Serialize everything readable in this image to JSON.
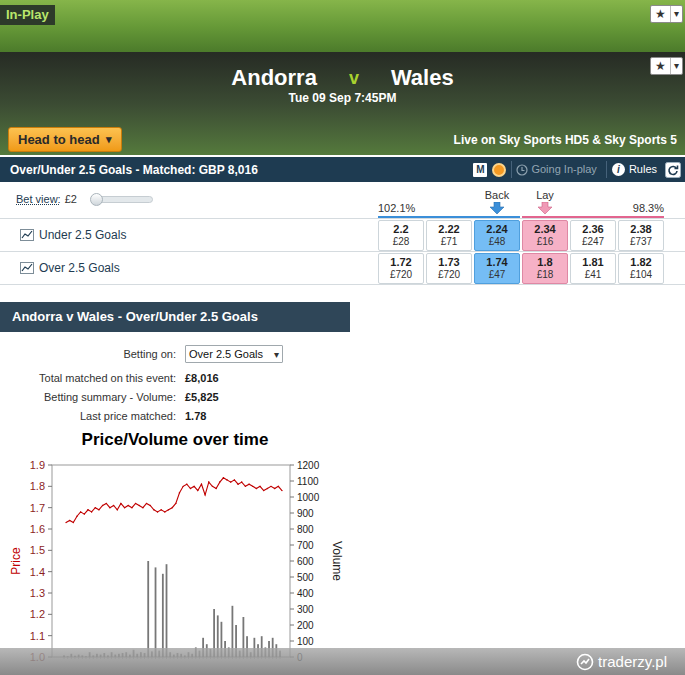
{
  "top_bar": {
    "label": "In-Play",
    "star": "★",
    "caret": "▾"
  },
  "event": {
    "home": "Andorra",
    "vs": "v",
    "away": "Wales",
    "datetime": "Tue 09 Sep 7:45PM",
    "head_to_head": "Head to head",
    "head_to_head_caret": "▾",
    "broadcast": "Live on Sky Sports HD5 & Sky Sports 5",
    "star": "★",
    "caret": "▾"
  },
  "market": {
    "title": "Over/Under 2.5 Goals - Matched: GBP 8,016",
    "m_badge": "M",
    "going_in_play": {
      "label": "Going In-play",
      "active": false
    },
    "info_badge": "i",
    "rules": "Rules"
  },
  "bet_view": {
    "label": "Bet view:",
    "amount": "£2",
    "level": 0
  },
  "columns": {
    "back": "Back",
    "lay": "Lay",
    "back_overround": "102.1%",
    "lay_overround": "98.3%"
  },
  "runners": [
    {
      "name": "Under 2.5 Goals",
      "prices": [
        {
          "price": "2.2",
          "size": "£28",
          "kind": "back",
          "best": false
        },
        {
          "price": "2.22",
          "size": "£71",
          "kind": "back",
          "best": false
        },
        {
          "price": "2.24",
          "size": "£48",
          "kind": "back",
          "best": true
        },
        {
          "price": "2.34",
          "size": "£16",
          "kind": "lay",
          "best": true
        },
        {
          "price": "2.36",
          "size": "£247",
          "kind": "lay",
          "best": false
        },
        {
          "price": "2.38",
          "size": "£737",
          "kind": "lay",
          "best": false
        }
      ]
    },
    {
      "name": "Over 2.5 Goals",
      "prices": [
        {
          "price": "1.72",
          "size": "£720",
          "kind": "back",
          "best": false
        },
        {
          "price": "1.73",
          "size": "£720",
          "kind": "back",
          "best": false
        },
        {
          "price": "1.74",
          "size": "£47",
          "kind": "back",
          "best": true
        },
        {
          "price": "1.8",
          "size": "£18",
          "kind": "lay",
          "best": true
        },
        {
          "price": "1.81",
          "size": "£41",
          "kind": "lay",
          "best": false
        },
        {
          "price": "1.82",
          "size": "£104",
          "kind": "lay",
          "best": false
        }
      ]
    }
  ],
  "summary": {
    "title": "Andorra v Wales - Over/Under 2.5 Goals",
    "betting_on_label": "Betting on:",
    "betting_on": "Over 2.5 Goals",
    "betting_on_caret": "▾",
    "rows": [
      {
        "label": "Total matched on this event:",
        "value": "£8,016"
      },
      {
        "label": "Betting summary - Volume:",
        "value": "£5,825"
      },
      {
        "label": "Last price matched:",
        "value": "1.78"
      }
    ]
  },
  "chart": {
    "title": "Price/Volume over time",
    "y_left_label": "Price",
    "y_right_label": "Volume",
    "y_left_ticks": [
      "1.9",
      "1.8",
      "1.7",
      "1.6",
      "1.5",
      "1.4",
      "1.3",
      "1.2",
      "1.1",
      "1.0"
    ],
    "y_right_ticks": [
      "1200",
      "1100",
      "1000",
      "900",
      "800",
      "700",
      "600",
      "500",
      "400",
      "300",
      "200",
      "100",
      "0"
    ],
    "price": [
      1.63,
      1.64,
      1.63,
      1.66,
      1.68,
      1.67,
      1.69,
      1.68,
      1.7,
      1.69,
      1.71,
      1.72,
      1.7,
      1.71,
      1.69,
      1.72,
      1.7,
      1.71,
      1.7,
      1.72,
      1.71,
      1.7,
      1.72,
      1.71,
      1.69,
      1.68,
      1.69,
      1.68,
      1.69,
      1.7,
      1.72,
      1.77,
      1.8,
      1.81,
      1.79,
      1.8,
      1.78,
      1.81,
      1.76,
      1.82,
      1.8,
      1.79,
      1.82,
      1.84,
      1.83,
      1.82,
      1.83,
      1.81,
      1.82,
      1.8,
      1.81,
      1.8,
      1.79,
      1.8,
      1.78,
      1.79,
      1.8,
      1.79,
      1.8,
      1.78
    ],
    "volume": [
      10,
      5,
      20,
      8,
      15,
      10,
      5,
      30,
      10,
      20,
      15,
      25,
      10,
      30,
      15,
      20,
      25,
      30,
      15,
      45,
      20,
      30,
      25,
      600,
      35,
      560,
      40,
      520,
      580,
      30,
      15,
      25,
      20,
      10,
      30,
      20,
      60,
      40,
      120,
      80,
      50,
      300,
      260,
      220,
      100,
      60,
      320,
      200,
      40,
      250,
      130,
      30,
      120,
      80,
      130,
      60,
      100,
      120,
      80,
      40
    ]
  },
  "watermark": "traderzy.pl"
}
